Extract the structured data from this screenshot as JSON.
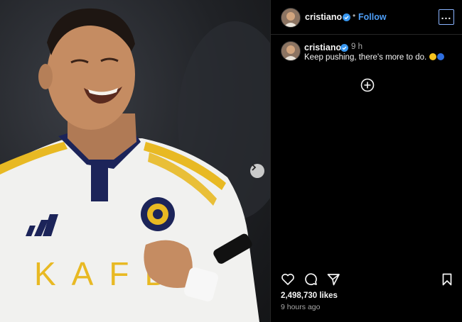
{
  "post": {
    "photo": {
      "description_icon": "photo",
      "jersey_text": "KAFD",
      "next_icon": "chevron-right-icon"
    },
    "header": {
      "username": "cristiano",
      "separator": "•",
      "follow_label": "Follow",
      "more_icon": "more-horizontal-icon"
    },
    "caption": {
      "username": "cristiano",
      "time": "9 h",
      "text": "Keep pushing, there's more to do."
    },
    "actions": {
      "like_icon": "heart-icon",
      "comment_icon": "comment-icon",
      "share_icon": "share-icon",
      "save_icon": "bookmark-icon",
      "add_icon": "plus-circle-icon"
    },
    "likes": "2,498,730 likes",
    "posted": "9 hours ago",
    "colors": {
      "background": "#000000",
      "link_blue": "#4d9ef7",
      "verified_blue": "#3897f0",
      "jersey_white": "#f2f2f0",
      "jersey_yellow": "#e8b923",
      "collar_navy": "#1c2459"
    }
  }
}
